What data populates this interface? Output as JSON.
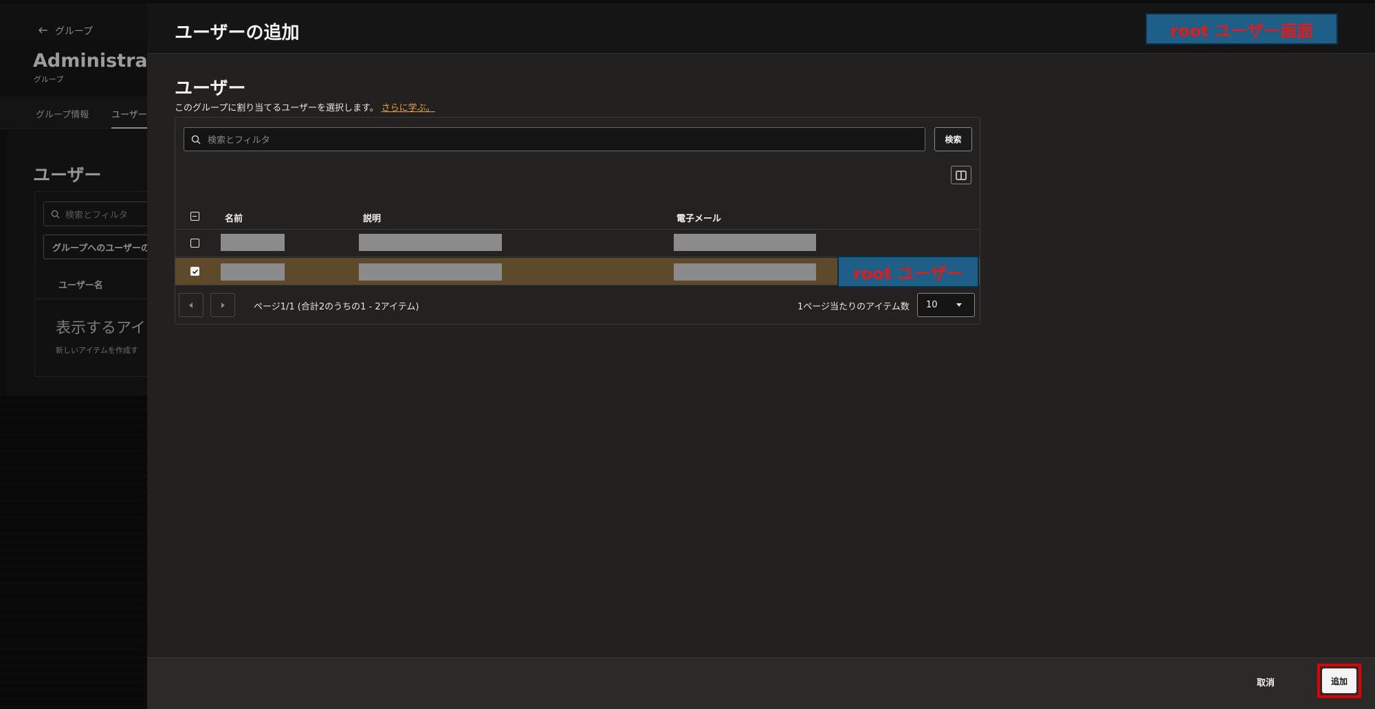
{
  "background": {
    "back_label": "グループ",
    "title": "Administrato",
    "subtitle": "グループ",
    "tabs": [
      "グループ情報",
      "ユーザー"
    ],
    "section_title": "ユーザー",
    "search_placeholder": "検索とフィルタ",
    "add_users_button": "グループへのユーザーの",
    "column_username": "ユーザー名",
    "empty_title": "表示するアイ",
    "empty_desc": "新しいアイテムを作成す"
  },
  "drawer": {
    "title": "ユーザーの追加",
    "section_title": "ユーザー",
    "description": "このグループに割り当てるユーザーを選択します。",
    "learn_more": "さらに学ぶ。",
    "search_placeholder": "検索とフィルタ",
    "search_button": "検索",
    "columns": [
      "名前",
      "説明",
      "電子メール"
    ],
    "rows": [
      {
        "selected": false
      },
      {
        "selected": true
      }
    ],
    "pagination_text": "ページ1/1 (合計2のうちの1 - 2アイテム)",
    "per_page_label": "1ページ当たりのアイテム数",
    "per_page_value": "10",
    "cancel_button": "取消",
    "add_button": "追加"
  },
  "annotations": {
    "top_label": "root ユーザー画面",
    "row_label": "root ユーザー",
    "label_bg": "#1d5f86",
    "label_text_color": "#e01b1b",
    "highlight_color": "#e00000"
  },
  "icons": [
    "arrow-left-icon",
    "search-icon",
    "columns-icon",
    "chevron-left-icon",
    "chevron-right-icon",
    "caret-down-icon",
    "checkbox-check-icon"
  ]
}
